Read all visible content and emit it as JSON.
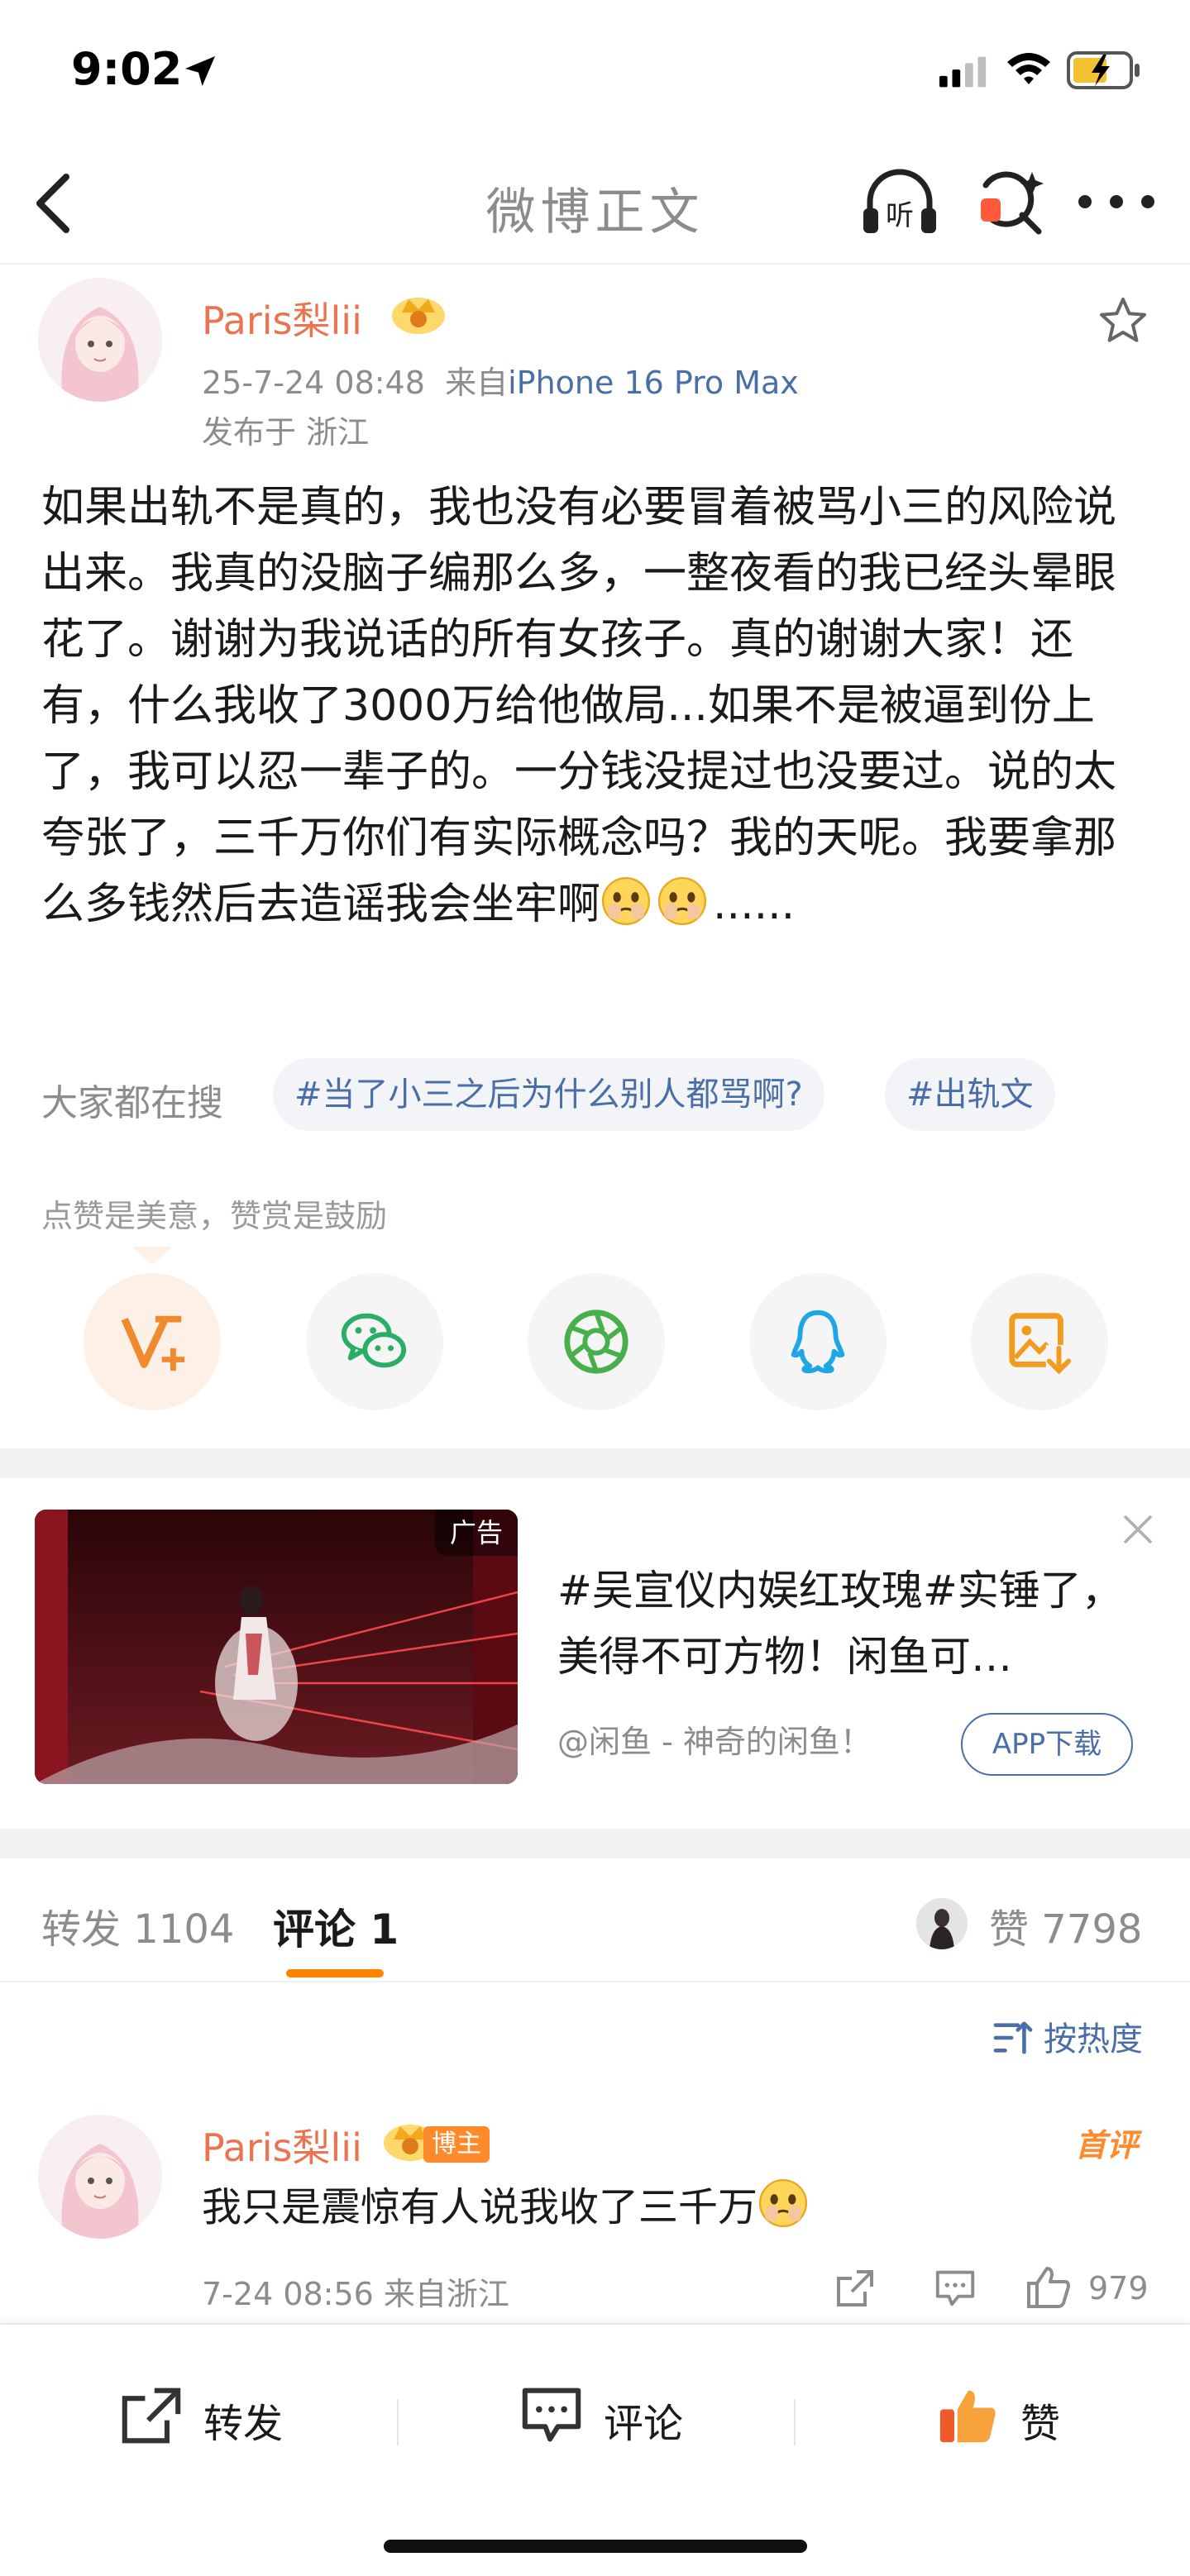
{
  "status_bar": {
    "time": "9:02"
  },
  "nav": {
    "title": "微博正文",
    "listen_icon_label": "听"
  },
  "post": {
    "author": "Paris梨lii",
    "timestamp": "25-7-24 08:48",
    "source_prefix": "来自",
    "device": "iPhone 16 Pro Max",
    "location": "发布于 浙江",
    "text_main": "如果出轨不是真的，我也没有必要冒着被骂小三的风险说出来。我真的没脑子编那么多，一整夜看的我已经头晕眼花了。谢谢为我说话的所有女孩子。真的谢谢大家！还有，什么我收了3000万给他做局...如果不是被逼到份上了，我可以忍一辈子的。一分钱没提过也没要过。说的太夸张了，三千万你们有实际概念吗？我的天呢。我要拿那么多钱然后去造谣我会坐牢啊",
    "text_tail": "......"
  },
  "search_topics": {
    "label": "大家都在搜",
    "topics": [
      "#当了小三之后为什么别人都骂啊?",
      "#出轨文"
    ]
  },
  "tip": "点赞是美意，赞赏是鼓励",
  "share": {
    "items": [
      "v-plus",
      "wechat",
      "moments",
      "qq",
      "save-image"
    ]
  },
  "ad": {
    "badge": "广告",
    "title": "#吴宣仪内娱红玫瑰#实锤了，美得不可方物！闲鱼可…",
    "source": "@闲鱼 - 神奇的闲鱼！",
    "download_label": "APP下载"
  },
  "tabs": {
    "repost": "转发 1104",
    "comment": "评论 1",
    "likes": "赞 7798"
  },
  "sort": {
    "label": "按热度"
  },
  "comment": {
    "author": "Paris梨lii",
    "badge": "博主",
    "first_label": "首评",
    "text": "我只是震惊有人说我收了三千万",
    "meta": "7-24 08:56  来自浙江",
    "like_count": "979"
  },
  "bottom_bar": {
    "repost": "转发",
    "comment": "评论",
    "like": "赞"
  },
  "colors": {
    "accent_orange": "#ff8200",
    "name_orange": "#eb7350",
    "link_blue": "#4a6ea8",
    "gray_text": "#8c8c8c"
  }
}
